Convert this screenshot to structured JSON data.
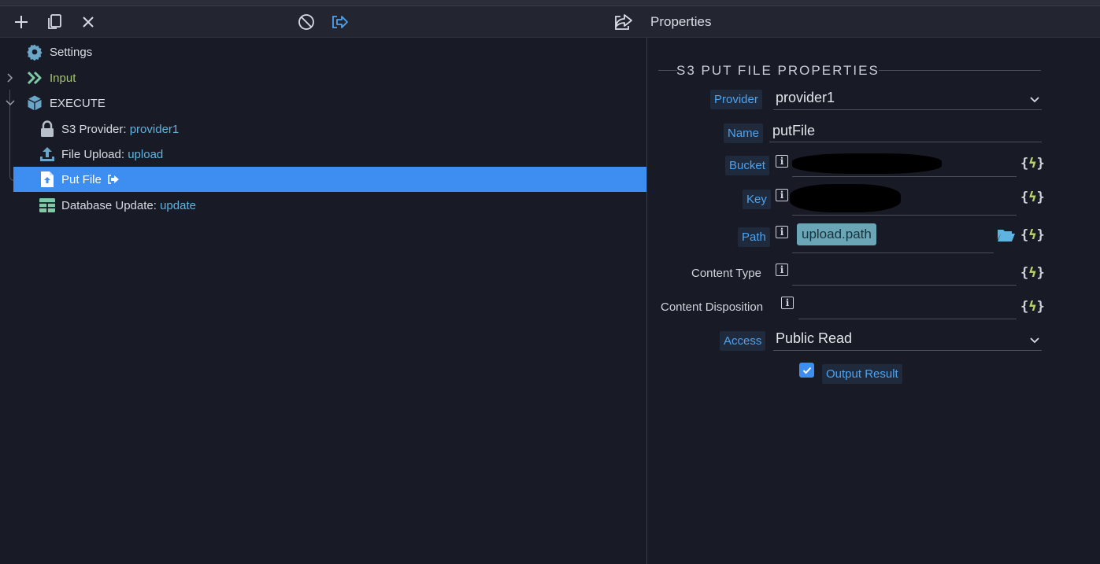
{
  "toolbar": {
    "add_icon": "plus-icon",
    "copy_icon": "copy-icon",
    "delete_icon": "close-icon",
    "disable_icon": "ban-icon",
    "output_icon": "output-arrow-icon",
    "share_icon": "share-icon"
  },
  "tree": {
    "items": [
      {
        "label": "Settings",
        "icon": "gear-icon"
      },
      {
        "label": "Input",
        "icon": "double-chevron-icon"
      },
      {
        "label": "EXECUTE",
        "icon": "cube-icon"
      },
      {
        "label": "S3 Provider:",
        "value": "provider1",
        "icon": "lock-icon"
      },
      {
        "label": "File Upload:",
        "value": "upload",
        "icon": "upload-icon"
      },
      {
        "label": "Put File",
        "icon": "file-upload-icon"
      },
      {
        "label": "Database Update:",
        "value": "update",
        "icon": "table-icon"
      }
    ]
  },
  "properties": {
    "panel_title": "Properties",
    "section_title": "S3 PUT FILE PROPERTIES",
    "provider": {
      "label": "Provider",
      "value": "provider1"
    },
    "name": {
      "label": "Name",
      "value": "putFile"
    },
    "bucket": {
      "label": "Bucket"
    },
    "key": {
      "label": "Key"
    },
    "path": {
      "label": "Path",
      "value": "upload.path"
    },
    "content_type": {
      "label": "Content Type"
    },
    "content_disposition": {
      "label": "Content Disposition"
    },
    "access": {
      "label": "Access",
      "value": "Public Read"
    },
    "output_result": {
      "label": "Output Result",
      "checked": true
    },
    "dynamic_symbol_open": "{",
    "dynamic_symbol_bolt": "ϟ",
    "dynamic_symbol_close": "}",
    "info_symbol": "i"
  },
  "colors": {
    "selected": "#3d8ef0",
    "accent_blue": "#4ea3f0",
    "value_blue": "#5fb3e0",
    "green": "#a3c36f",
    "dynamic_green": "#b9d36b"
  }
}
